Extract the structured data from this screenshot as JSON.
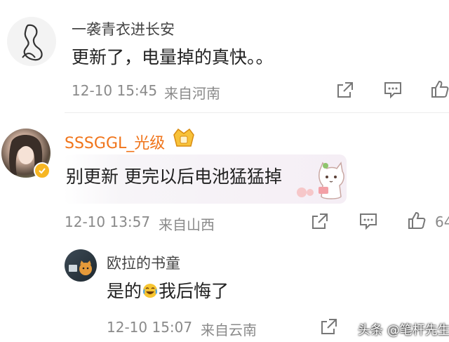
{
  "comments": [
    {
      "username": "一袭青衣进长安",
      "text": "更新了，电量掉的真快。。",
      "time": "12-10 15:45",
      "location": "来自河南"
    },
    {
      "username": "SSSGGL_光级",
      "text": "别更新 更完以后电池猛猛掉",
      "time": "12-10 13:57",
      "location": "来自山西",
      "like_count": "64"
    },
    {
      "username": "欧拉的书童",
      "text_before": "是的",
      "text_after": "我后悔了",
      "time": "12-10 15:07",
      "location": "来自云南"
    }
  ],
  "watermark": "头条 @笔杆先生",
  "colors": {
    "vip_name": "#f0741a",
    "meta": "#8a8a8a",
    "icon": "#777777",
    "verified_badge": "#f6b623"
  },
  "icons": {
    "share": "share-icon",
    "comment": "comment-icon",
    "like": "thumbs-up-icon"
  }
}
